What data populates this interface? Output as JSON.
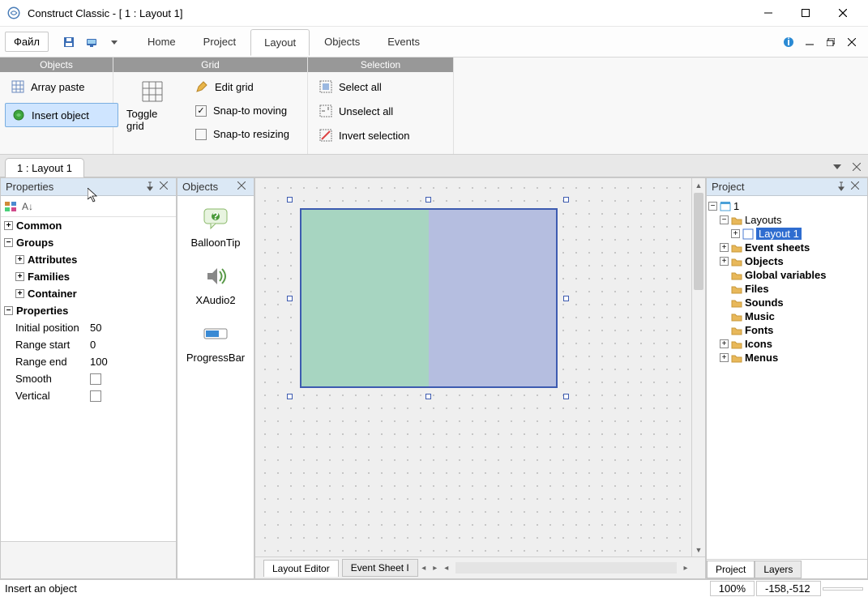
{
  "window": {
    "title": "Construct Classic - [ 1 : Layout 1]"
  },
  "toolbar": {
    "file_label": "Файл",
    "tabs": [
      "Home",
      "Project",
      "Layout",
      "Objects",
      "Events"
    ],
    "active_tab_index": 2
  },
  "ribbon": {
    "groups": {
      "objects": {
        "title": "Objects",
        "array_paste": "Array paste",
        "insert_object": "Insert object"
      },
      "grid": {
        "title": "Grid",
        "toggle_grid": "Toggle grid",
        "edit_grid": "Edit grid",
        "snap_moving": "Snap-to moving",
        "snap_resizing": "Snap-to resizing",
        "snap_moving_checked": true,
        "snap_resizing_checked": false
      },
      "selection": {
        "title": "Selection",
        "select_all": "Select all",
        "unselect_all": "Unselect all",
        "invert_selection": "Invert selection"
      }
    }
  },
  "doc_tab": "1 : Layout 1",
  "properties_panel": {
    "title": "Properties",
    "groups": {
      "common": "Common",
      "groups": "Groups",
      "attributes": "Attributes",
      "families": "Families",
      "container": "Container",
      "properties": "Properties"
    },
    "props": {
      "initial_position": {
        "label": "Initial position",
        "value": "50"
      },
      "range_start": {
        "label": "Range start",
        "value": "0"
      },
      "range_end": {
        "label": "Range end",
        "value": "100"
      },
      "smooth": {
        "label": "Smooth",
        "checked": false
      },
      "vertical": {
        "label": "Vertical",
        "checked": false
      }
    }
  },
  "objects_panel": {
    "title": "Objects",
    "items": [
      "BalloonTip",
      "XAudio2",
      "ProgressBar"
    ]
  },
  "canvas": {
    "tabs": [
      "Layout Editor",
      "Event Sheet I"
    ],
    "active_tab_index": 0
  },
  "project_panel": {
    "title": "Project",
    "root": "1",
    "layouts": "Layouts",
    "layout1": "Layout 1",
    "event_sheets": "Event sheets",
    "objects": "Objects",
    "global_variables": "Global variables",
    "files": "Files",
    "sounds": "Sounds",
    "music": "Music",
    "fonts": "Fonts",
    "icons": "Icons",
    "menus": "Menus",
    "bottom_tabs": [
      "Project",
      "Layers"
    ]
  },
  "status": {
    "message": "Insert an object",
    "zoom": "100%",
    "coords": "-158,-512"
  }
}
